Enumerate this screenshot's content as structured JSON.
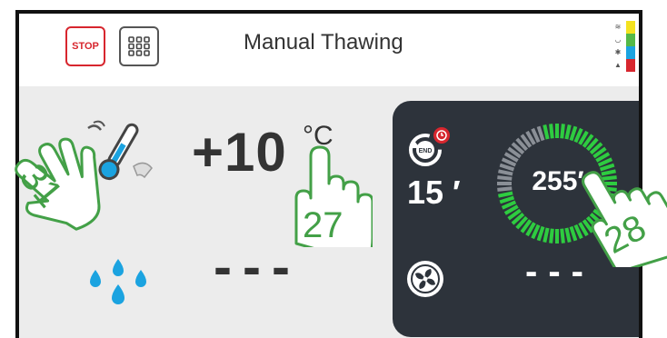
{
  "header": {
    "stop_label": "STOP",
    "title": "Manual Thawing"
  },
  "legend": {
    "colors": [
      "#f4e21f",
      "#55b947",
      "#1ba3e0",
      "#d7262e"
    ]
  },
  "main": {
    "temperature": {
      "value": "+10",
      "unit": "°C"
    },
    "humidity": {
      "value": "---"
    }
  },
  "panel": {
    "time_value": "15 ′",
    "ring_value": "255′",
    "fan_value": "---"
  },
  "annotations": {
    "hand_1": "31",
    "hand_2": "27",
    "hand_3": "28"
  },
  "colors": {
    "accent_green": "#43a047",
    "ring_green": "#2ecc40",
    "stop_red": "#d7262e",
    "water_blue": "#1ba3e0",
    "panel_bg": "#2d333b"
  },
  "icons": [
    "stop-icon",
    "grid-menu-icon",
    "thermometer-icon",
    "water-drops-icon",
    "end-timer-icon",
    "fan-icon",
    "hand-pointer-icon"
  ]
}
